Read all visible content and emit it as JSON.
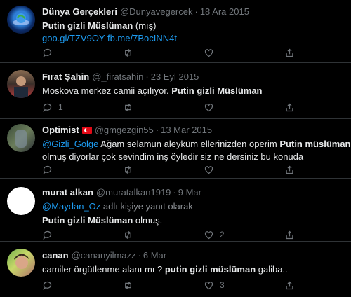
{
  "tweets": [
    {
      "name": "Dünya Gerçekleri",
      "handle": "@Dunyavegercek",
      "date": "18 Ara 2015",
      "line1_bold": "Putin gizli Müslüman",
      "line1_rest": " (mış)",
      "line2_link": "goo.gl/TZV9OY fb.me/7BocINN4t",
      "reply": "",
      "retweet": "",
      "like": ""
    },
    {
      "name": "Fırat Şahin",
      "handle": "@_firatsahin",
      "date": "23 Eyl 2015",
      "line1_pre": "Moskova merkez camii  açılıyor. ",
      "line1_bold": "Putin gizli Müslüman",
      "reply": "1",
      "retweet": "",
      "like": ""
    },
    {
      "name": "Optimist",
      "handle": "@gmgezgin55",
      "date": "13 Mar 2015",
      "line1_link": "@Gizli_Golge",
      "line1_pre": " Ağam selamun aleyküm ellerinizden öperim ",
      "line1_bold": "Putin müslüman",
      "line2": "olmuş diyorlar çok sevindim inş öyledir siz ne dersiniz bu konuda",
      "reply": "",
      "retweet": "",
      "like": ""
    },
    {
      "name": "murat alkan",
      "handle": "@muratalkan1919",
      "date": "9 Mar",
      "line1_link": "@Maydan_Oz",
      "line1_rest": " adlı kişiye yanıt olarak",
      "line2_bold": "Putin gizli Müslüman",
      "line2_rest": " olmuş.",
      "reply": "",
      "retweet": "",
      "like": "2"
    },
    {
      "name": "canan",
      "handle": "@cananyilmazz",
      "date": "6 Mar",
      "line1_pre": "camiler örgütlenme alanı mı ? ",
      "line1_bold": "putin gizli müslüman",
      "line1_rest": " galiba..",
      "reply": "",
      "retweet": "",
      "like": "3"
    }
  ],
  "dot": "·"
}
